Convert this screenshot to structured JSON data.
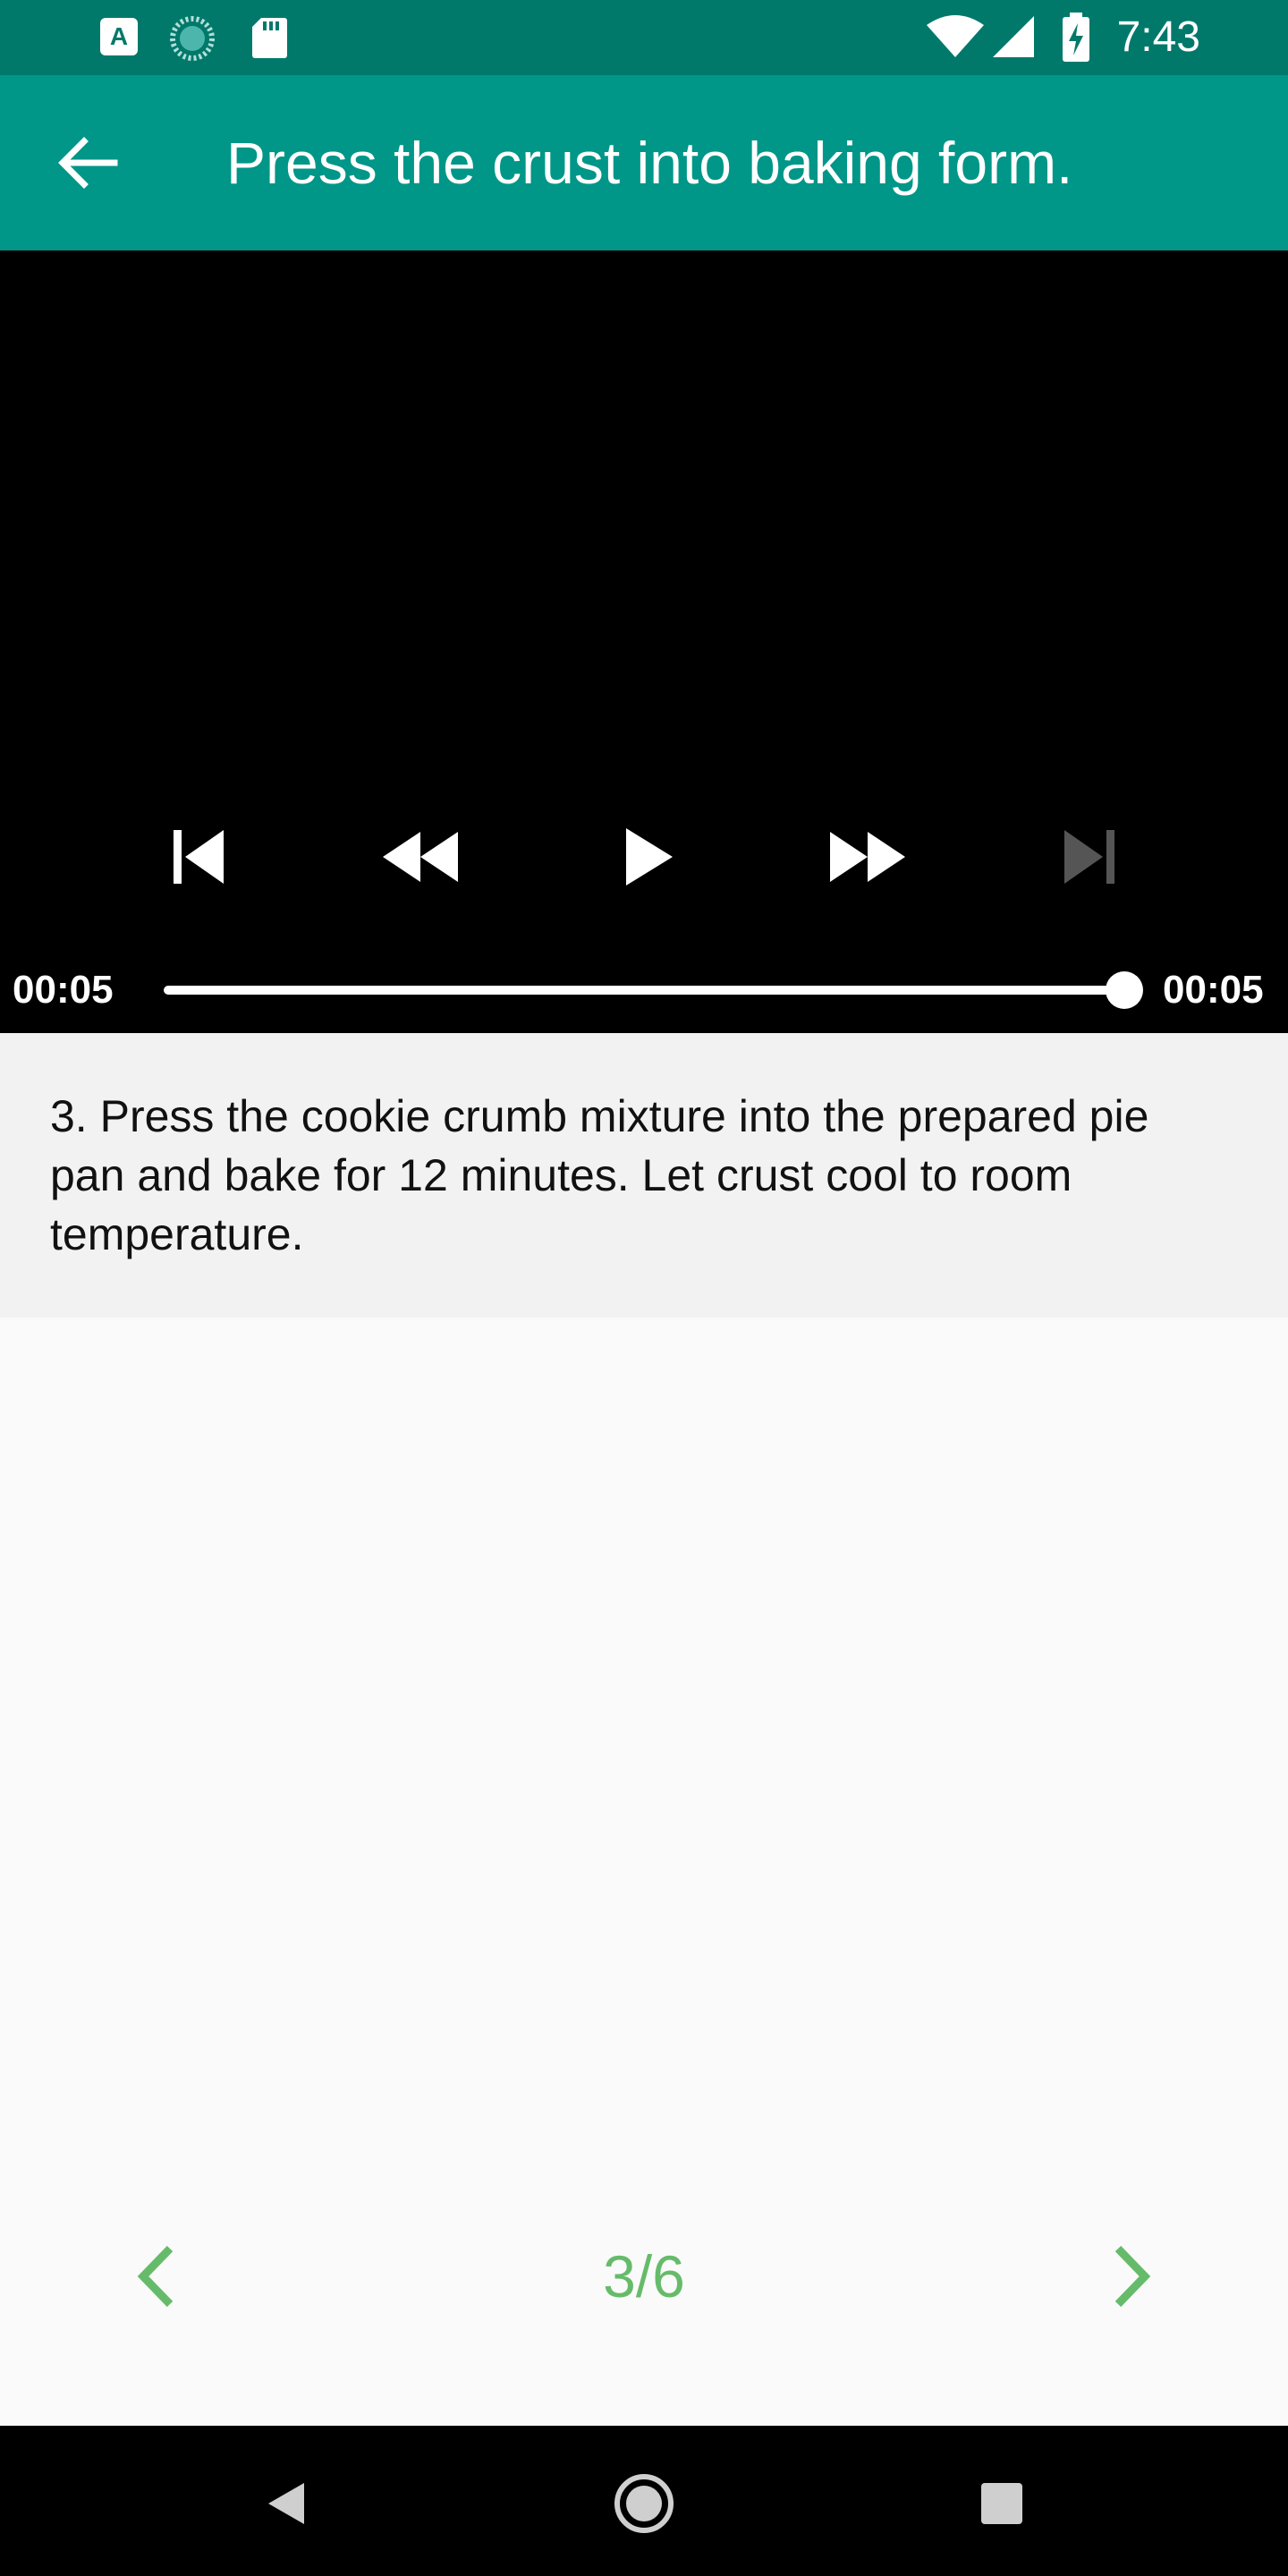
{
  "status_bar": {
    "time": "7:43",
    "left_icons": [
      "text-a-icon",
      "loading-icon",
      "sd-card-icon"
    ],
    "right_icons": [
      "wifi-icon",
      "signal-icon",
      "battery-charging-icon"
    ]
  },
  "app_bar": {
    "title": "Press the crust into baking form.",
    "back_icon": "arrow-back-icon"
  },
  "player": {
    "controls": [
      "skip-previous-icon",
      "rewind-icon",
      "play-icon",
      "fast-forward-icon",
      "skip-next-icon"
    ],
    "position_label": "00:05",
    "duration_label": "00:05",
    "progress": 1.0
  },
  "step": {
    "text": "3. Press the cookie crumb mixture into the prepared pie pan and bake for 12 minutes. Let crust cool to room temperature."
  },
  "pager": {
    "indicator": "3/6",
    "prev_icon": "chevron-left-icon",
    "next_icon": "chevron-right-icon"
  },
  "nav_bar": {
    "buttons": [
      "back-triangle-icon",
      "home-circle-icon",
      "recents-square-icon"
    ]
  },
  "colors": {
    "status_bar": "#00796b",
    "app_bar": "#009688",
    "accent_green": "#66bb6a",
    "player_bg": "#000000"
  }
}
